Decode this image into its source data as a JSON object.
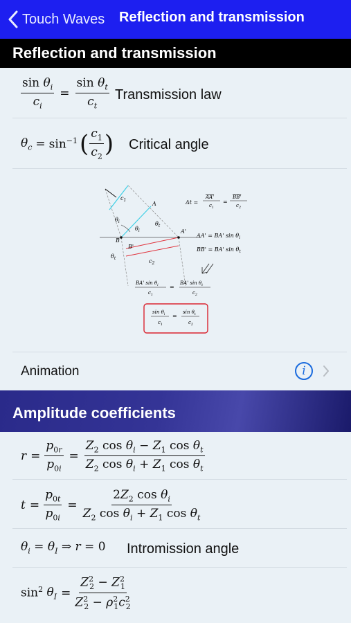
{
  "navbar": {
    "back_label": "Touch Waves",
    "title": "Reflection and transmission"
  },
  "section1": {
    "header": "Reflection and transmission",
    "rows": [
      {
        "label": "Transmission law"
      },
      {
        "label": "Critical angle"
      }
    ],
    "diagram": {
      "delta_t": "Δt =",
      "eq_aa_bb": "AA′ = BA′ sin θi",
      "eq_bb": "BB′ = BA′ sin θt"
    },
    "animation_label": "Animation"
  },
  "section2": {
    "header": "Amplitude coefficients",
    "intromission_label": "Intromission angle"
  },
  "colors": {
    "navbar": "#1d1ff0",
    "accent": "#1a6bde",
    "highlight_box": "#d9232e",
    "wavefront": "#3fd0e6"
  }
}
